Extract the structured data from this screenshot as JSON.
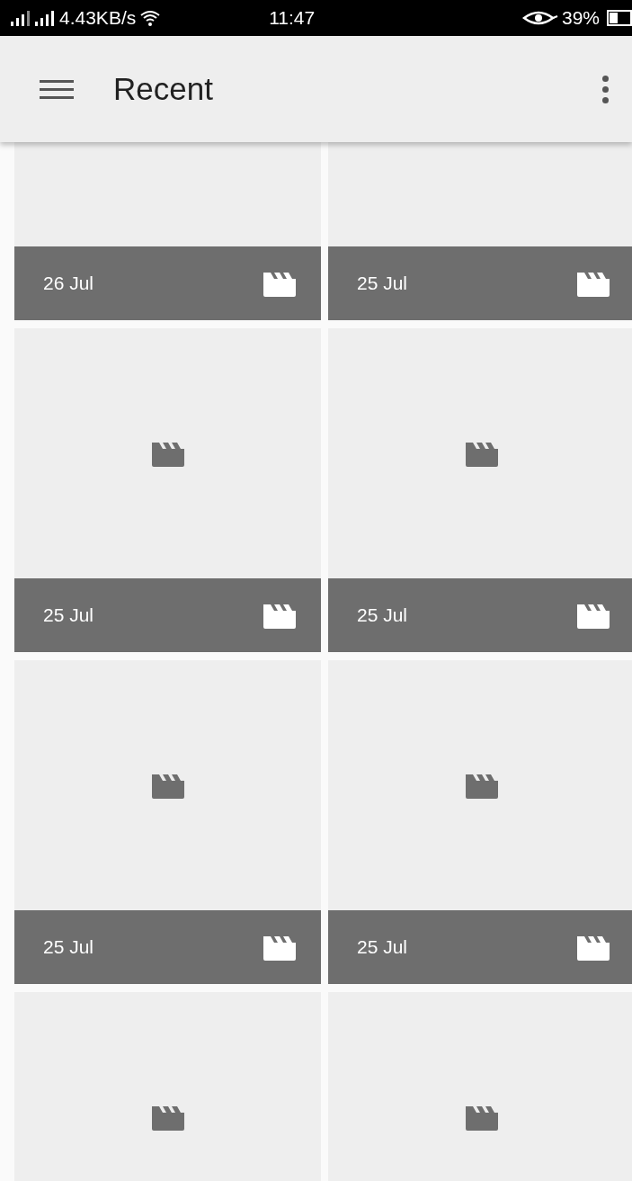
{
  "status_bar": {
    "speed": "4.43KB/s",
    "time": "11:47",
    "battery": "39%"
  },
  "app_bar": {
    "title": "Recent"
  },
  "tiles": [
    {
      "kind": "video",
      "date": "26 Jul"
    },
    {
      "kind": "video",
      "date": "25 Jul"
    },
    {
      "kind": "video",
      "date": "25 Jul"
    },
    {
      "kind": "video",
      "date": "25 Jul"
    },
    {
      "kind": "video",
      "date": "25 Jul"
    },
    {
      "kind": "video",
      "date": "25 Jul"
    },
    {
      "kind": "video"
    },
    {
      "kind": "video"
    }
  ]
}
